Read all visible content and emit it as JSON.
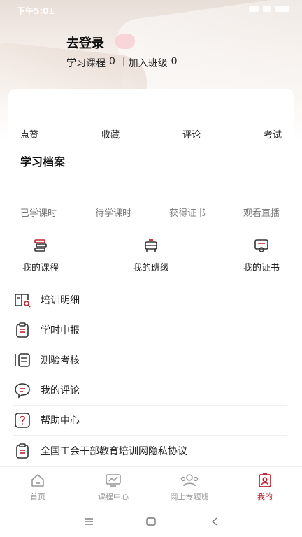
{
  "status": {
    "time": "下午5:01"
  },
  "profile": {
    "login_label": "去登录",
    "courses_label": "学习课程",
    "courses_count": "0",
    "classes_label": "加入班级",
    "classes_count": "0",
    "separator": "|"
  },
  "actions": [
    {
      "label": "点赞"
    },
    {
      "label": "收藏"
    },
    {
      "label": "评论"
    },
    {
      "label": "考试"
    }
  ],
  "archive": {
    "title": "学习档案",
    "stats": [
      {
        "label": "已学课时"
      },
      {
        "label": "待学课时"
      },
      {
        "label": "获得证书"
      },
      {
        "label": "观看直播"
      }
    ]
  },
  "quick_links": [
    {
      "label": "我的课程",
      "icon": "books-icon"
    },
    {
      "label": "我的班级",
      "icon": "classroom-icon"
    },
    {
      "label": "我的证书",
      "icon": "certificate-icon"
    }
  ],
  "menu": [
    {
      "label": "培训明细",
      "icon": "book-search-icon"
    },
    {
      "label": "学时申报",
      "icon": "clipboard-icon"
    },
    {
      "label": "测验考核",
      "icon": "pencil-list-icon"
    },
    {
      "label": "我的评论",
      "icon": "chat-bubble-icon"
    },
    {
      "label": "帮助中心",
      "icon": "question-icon"
    },
    {
      "label": "全国工会干部教育培训网隐私协议",
      "icon": "clipboard-icon"
    }
  ],
  "tabbar": [
    {
      "label": "首页",
      "icon": "home-icon",
      "active": false
    },
    {
      "label": "课程中心",
      "icon": "screen-chart-icon",
      "active": false
    },
    {
      "label": "网上专题班",
      "icon": "group-icon",
      "active": false
    },
    {
      "label": "我的",
      "icon": "profile-badge-icon",
      "active": true
    }
  ],
  "colors": {
    "accent": "#c0242f",
    "text": "#222222",
    "muted": "#777777",
    "tab_inactive": "#999999"
  }
}
